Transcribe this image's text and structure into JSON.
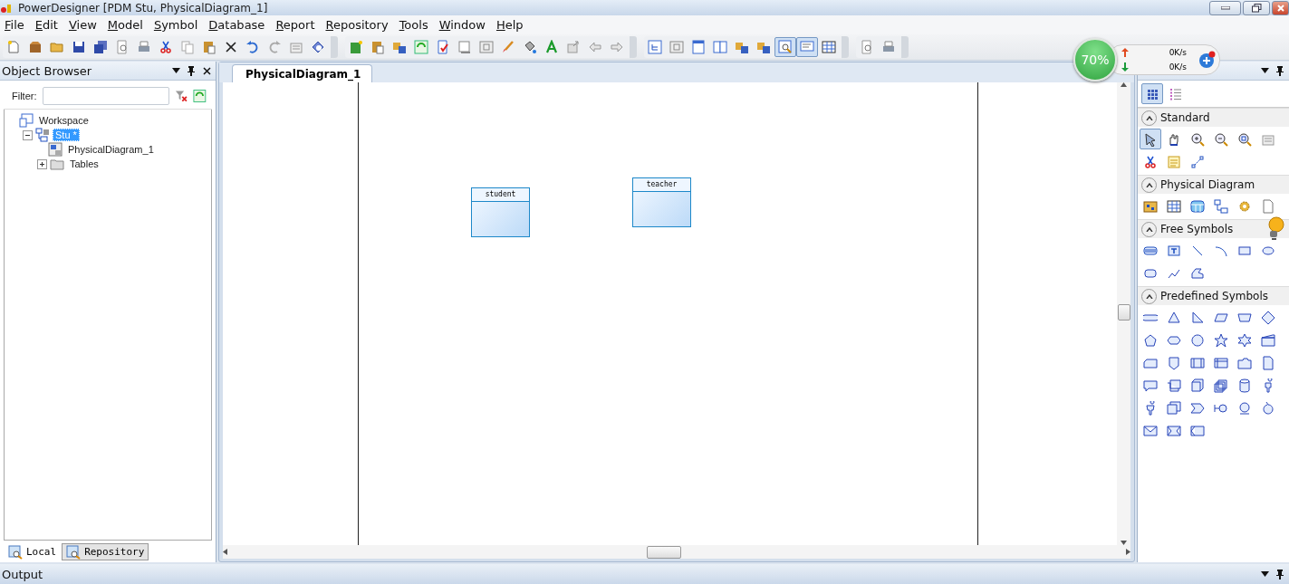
{
  "window": {
    "title": "PowerDesigner [PDM Stu, PhysicalDiagram_1]"
  },
  "menu": [
    {
      "label": "File"
    },
    {
      "label": "Edit"
    },
    {
      "label": "View"
    },
    {
      "label": "Model"
    },
    {
      "label": "Symbol"
    },
    {
      "label": "Database"
    },
    {
      "label": "Report"
    },
    {
      "label": "Repository"
    },
    {
      "label": "Tools"
    },
    {
      "label": "Window"
    },
    {
      "label": "Help"
    }
  ],
  "toolbars": [
    {
      "buttons": [
        {
          "pressed": false
        },
        {
          "pressed": false
        },
        {
          "pressed": false
        },
        {
          "pressed": false
        },
        {
          "pressed": false
        },
        {
          "pressed": false
        },
        {
          "pressed": false
        },
        {
          "pressed": false
        },
        {
          "pressed": false
        },
        {
          "pressed": false
        },
        {
          "pressed": false
        },
        {
          "pressed": false
        },
        {
          "pressed": false
        },
        {
          "pressed": false
        },
        {
          "pressed": false
        }
      ]
    },
    {
      "buttons": [
        {
          "pressed": false
        },
        {
          "pressed": false
        },
        {
          "pressed": false
        },
        {
          "pressed": false
        },
        {
          "pressed": false
        },
        {
          "pressed": false
        },
        {
          "pressed": false
        },
        {
          "pressed": false
        },
        {
          "pressed": false
        },
        {
          "pressed": false
        },
        {
          "pressed": false
        },
        {
          "pressed": false
        },
        {
          "pressed": false
        }
      ]
    },
    {
      "buttons": [
        {
          "pressed": false
        },
        {
          "pressed": false
        },
        {
          "pressed": false
        },
        {
          "pressed": false
        },
        {
          "pressed": false
        },
        {
          "pressed": false
        },
        {
          "pressed": true
        },
        {
          "pressed": true
        },
        {
          "pressed": false
        }
      ]
    },
    {
      "buttons": [
        {
          "pressed": false
        },
        {
          "pressed": false
        }
      ]
    }
  ],
  "object_browser": {
    "title": "Object Browser",
    "filter": {
      "label": "Filter:"
    },
    "tree": [
      {
        "label": "Workspace",
        "selected": false,
        "expanded": true,
        "children": [
          {
            "label": "Stu *",
            "selected": true,
            "expanded": true,
            "children": [
              {
                "label": "PhysicalDiagram_1",
                "selected": false
              },
              {
                "label": "Tables",
                "selected": false,
                "expanded": false
              }
            ]
          }
        ]
      }
    ],
    "bottom_tabs": [
      {
        "label": "Local",
        "selected": true
      },
      {
        "label": "Repository",
        "selected": false
      }
    ]
  },
  "document_tabs": [
    {
      "label": "PhysicalDiagram_1",
      "selected": true
    }
  ],
  "diagram": {
    "tables": [
      {
        "name": "student"
      },
      {
        "name": "teacher"
      }
    ]
  },
  "toolbox": {
    "view_buttons": [
      {
        "selected": true
      },
      {
        "selected": false
      }
    ],
    "sections": [
      {
        "title": "Standard",
        "expanded": true,
        "tools": [
          {
            "selected": true
          },
          {
            "selected": false
          },
          {
            "selected": false
          },
          {
            "selected": false
          },
          {
            "selected": false
          },
          {
            "selected": false
          },
          {
            "selected": false
          },
          {
            "selected": false
          },
          {
            "selected": false
          }
        ]
      },
      {
        "title": "Physical Diagram",
        "expanded": true,
        "tools": [
          {
            "selected": false
          },
          {
            "selected": false
          },
          {
            "selected": false
          },
          {
            "selected": false
          },
          {
            "selected": false
          },
          {
            "selected": false
          }
        ]
      },
      {
        "title": "Free Symbols",
        "expanded": true,
        "tools": [
          {
            "selected": false
          },
          {
            "selected": false
          },
          {
            "selected": false
          },
          {
            "selected": false
          },
          {
            "selected": false
          },
          {
            "selected": false
          },
          {
            "selected": false
          },
          {
            "selected": false
          },
          {
            "selected": false
          }
        ]
      },
      {
        "title": "Predefined Symbols",
        "expanded": true,
        "tools": [
          {
            "selected": false
          },
          {
            "selected": false
          },
          {
            "selected": false
          },
          {
            "selected": false
          },
          {
            "selected": false
          },
          {
            "selected": false
          },
          {
            "selected": false
          },
          {
            "selected": false
          },
          {
            "selected": false
          },
          {
            "selected": false
          },
          {
            "selected": false
          },
          {
            "selected": false
          },
          {
            "selected": false
          },
          {
            "selected": false
          },
          {
            "selected": false
          },
          {
            "selected": false
          },
          {
            "selected": false
          },
          {
            "selected": false
          },
          {
            "selected": false
          },
          {
            "selected": false
          },
          {
            "selected": false
          },
          {
            "selected": false
          },
          {
            "selected": false
          },
          {
            "selected": false
          },
          {
            "selected": false
          },
          {
            "selected": false
          },
          {
            "selected": false
          },
          {
            "selected": false
          },
          {
            "selected": false
          },
          {
            "selected": false
          },
          {
            "selected": false
          },
          {
            "selected": false
          },
          {
            "selected": false
          }
        ]
      }
    ]
  },
  "output": {
    "title": "Output"
  },
  "net_monitor": {
    "percent": "70%",
    "upload": "0K/s",
    "download": "0K/s"
  }
}
